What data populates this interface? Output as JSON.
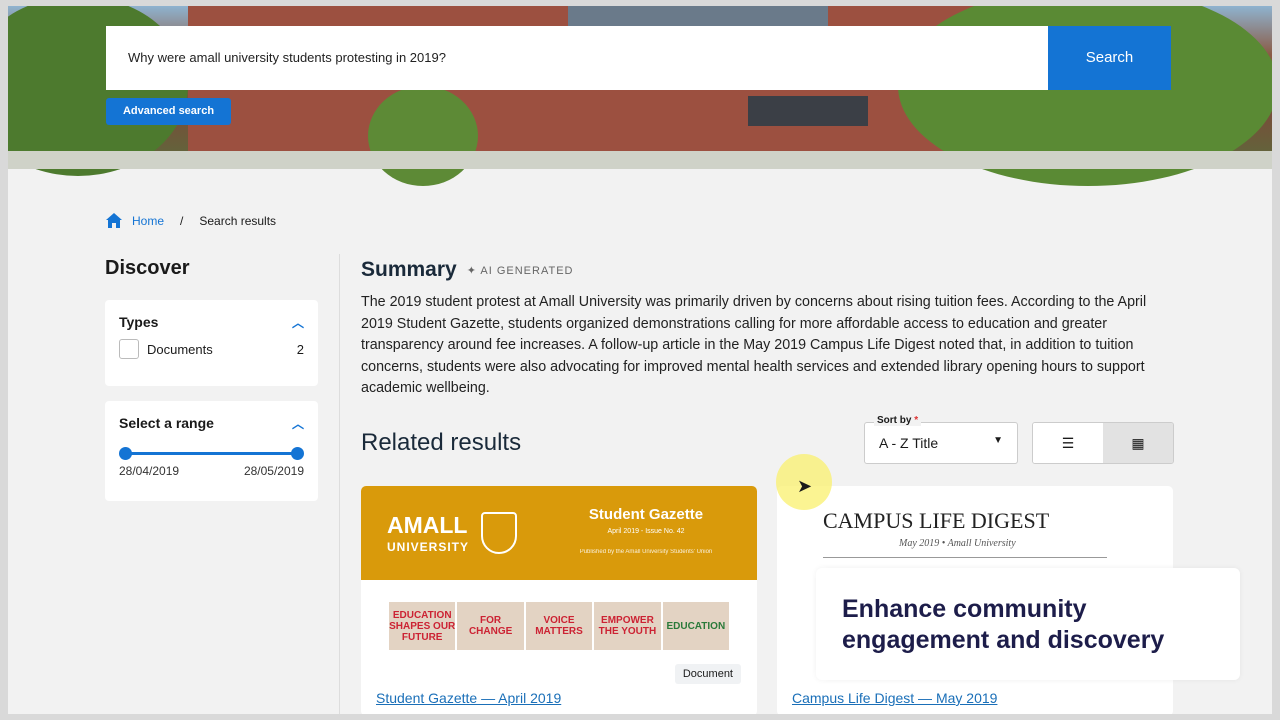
{
  "search": {
    "query": "Why were amall university students protesting in 2019?",
    "button": "Search",
    "advanced": "Advanced search"
  },
  "breadcrumb": {
    "home": "Home",
    "sep": "/",
    "current": "Search results"
  },
  "sidebar": {
    "title": "Discover",
    "types": {
      "title": "Types",
      "items": [
        {
          "label": "Documents",
          "count": "2"
        }
      ]
    },
    "range": {
      "title": "Select a range",
      "from": "28/04/2019",
      "to": "28/05/2019"
    }
  },
  "summary": {
    "title": "Summary",
    "badge": "AI GENERATED",
    "text": "The 2019 student protest at Amall University was primarily driven by concerns about rising tuition fees. According to the April 2019 Student Gazette, students organized demonstrations calling for more affordable access to education and greater transparency around fee increases. A follow-up article in the May 2019 Campus Life Digest noted that, in addition to tuition concerns, students were also advocating for improved mental health services and extended library opening hours to support academic wellbeing."
  },
  "results": {
    "title": "Related results",
    "sort_label": "Sort by",
    "sort_required": "*",
    "sort_value": "A - Z Title",
    "cards": [
      {
        "logo": "AMALL",
        "logo_sub": "UNIVERSITY",
        "header_title": "Student Gazette",
        "header_sub": "April 2019 - Issue No. 42",
        "header_pub": "Published by the Amall University Students' Union",
        "signs": [
          "EDUCATION SHAPES OUR FUTURE",
          "FOR CHANGE",
          "VOICE MATTERS",
          "EMPOWER THE YOUTH",
          "EDUCATION"
        ],
        "badge": "Document",
        "link": "Student Gazette — April 2019"
      },
      {
        "header_title": "CAMPUS LIFE DIGEST",
        "header_sub": "May 2019 • Amall University",
        "link": "Campus Life Digest — May 2019"
      }
    ]
  },
  "overlay": {
    "text": "Enhance community engagement and discovery"
  },
  "colors": {
    "accent": "#1474d4",
    "gazette": "#d99a0b"
  }
}
